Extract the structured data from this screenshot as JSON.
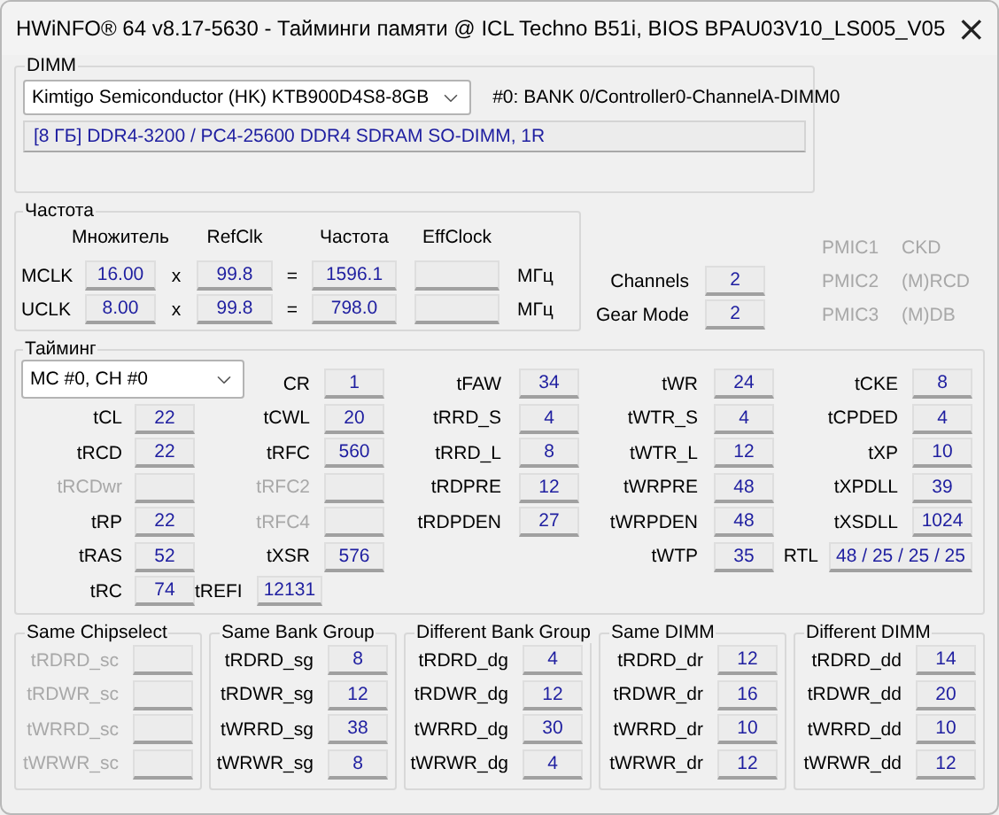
{
  "window": {
    "title": "HWiNFO® 64 v8.17-5630 - Тайминги памяти @ ICL Techno B51i, BIOS BPAU03V10_LS005_V05",
    "close": "×"
  },
  "dimm": {
    "title": "DIMM",
    "module": "Kimtigo Semiconductor (HK) KTB900D4S8-8GB",
    "slot": "#0: BANK 0/Controller0-ChannelA-DIMM0",
    "info": "[8 ГБ] DDR4-3200 / PC4-25600 DDR4 SDRAM SO-DIMM, 1R"
  },
  "frequency": {
    "title": "Частота",
    "columns": [
      "Множитель",
      "RefClk",
      "Частота",
      "EffClock"
    ],
    "rows": [
      {
        "label": "MCLK",
        "multiplier": "16.00",
        "times": "x",
        "refclk": "99.8",
        "equals": "=",
        "frequency": "1596.1",
        "unit": "МГц"
      },
      {
        "label": "UCLK",
        "multiplier": "8.00",
        "times": "x",
        "refclk": "99.8",
        "equals": "=",
        "frequency": "798.0",
        "unit": "МГц"
      }
    ]
  },
  "channels": [
    {
      "label": "Channels",
      "value": "2"
    },
    {
      "label": "Gear Mode",
      "value": "2"
    }
  ],
  "pmic": [
    {
      "label": "PMIC1",
      "value": "CKD",
      "disabled": true
    },
    {
      "label": "PMIC2",
      "value": "(M)RCD",
      "disabled": true
    },
    {
      "label": "PMIC3",
      "value": "(M)DB",
      "disabled": true
    }
  ],
  "timing": {
    "title": "Тайминг",
    "controller": "MC #0, CH #0",
    "columns": [
      [
        {
          "label": "tCL",
          "value": "22",
          "disabled": false
        },
        {
          "label": "tRCD",
          "value": "22",
          "disabled": false
        },
        {
          "label": "tRCDwr",
          "disabled": true
        },
        {
          "label": "tRP",
          "value": "22",
          "disabled": false
        },
        {
          "label": "tRAS",
          "value": "52",
          "disabled": false
        },
        {
          "label": "tRC",
          "value": "74",
          "disabled": false
        }
      ],
      [
        {
          "label": "CR",
          "value": "1",
          "disabled": false
        },
        {
          "label": "tCWL",
          "value": "20",
          "disabled": false
        },
        {
          "label": "tRFC",
          "value": "560",
          "disabled": false
        },
        {
          "label": "tRFC2",
          "disabled": true
        },
        {
          "label": "tRFC4",
          "disabled": true
        },
        {
          "label": "tXSR",
          "value": "576",
          "disabled": false
        },
        {
          "label": "tREFI",
          "value": "12131",
          "disabled": false
        }
      ],
      [
        {
          "label": "tFAW",
          "value": "34",
          "disabled": false
        },
        {
          "label": "tRRD_S",
          "value": "4",
          "disabled": false
        },
        {
          "label": "tRRD_L",
          "value": "8",
          "disabled": false
        },
        {
          "label": "tRDPRE",
          "value": "12",
          "disabled": false
        },
        {
          "label": "tRDPDEN",
          "value": "27",
          "disabled": false
        }
      ],
      [
        {
          "label": "tWR",
          "value": "24",
          "disabled": false
        },
        {
          "label": "tWTR_S",
          "value": "4",
          "disabled": false
        },
        {
          "label": "tWTR_L",
          "value": "12",
          "disabled": false
        },
        {
          "label": "tWRPRE",
          "value": "48",
          "disabled": false
        },
        {
          "label": "tWRPDEN",
          "value": "48",
          "disabled": false
        },
        {
          "label": "tWTP",
          "value": "35",
          "disabled": false
        }
      ],
      [
        {
          "label": "tCKE",
          "value": "8",
          "disabled": false
        },
        {
          "label": "tCPDED",
          "value": "4",
          "disabled": false
        },
        {
          "label": "tXP",
          "value": "10",
          "disabled": false
        },
        {
          "label": "tXPDLL",
          "value": "39",
          "disabled": false
        },
        {
          "label": "tXSDLL",
          "value": "1024",
          "disabled": false
        },
        {
          "label": "RTL",
          "value": "48 / 25 / 25 / 25",
          "disabled": false,
          "kind": "wide"
        }
      ]
    ]
  },
  "groups": [
    {
      "title": "Same Chipselect",
      "items": [
        {
          "label": "tRDRD_sc",
          "disabled": true
        },
        {
          "label": "tRDWR_sc",
          "disabled": true
        },
        {
          "label": "tWRRD_sc",
          "disabled": true
        },
        {
          "label": "tWRWR_sc",
          "disabled": true
        }
      ]
    },
    {
      "title": "Same Bank Group",
      "items": [
        {
          "label": "tRDRD_sg",
          "value": "8",
          "disabled": false
        },
        {
          "label": "tRDWR_sg",
          "value": "12",
          "disabled": false
        },
        {
          "label": "tWRRD_sg",
          "value": "38",
          "disabled": false
        },
        {
          "label": "tWRWR_sg",
          "value": "8",
          "disabled": false
        }
      ]
    },
    {
      "title": "Different Bank Group",
      "items": [
        {
          "label": "tRDRD_dg",
          "value": "4",
          "disabled": false
        },
        {
          "label": "tRDWR_dg",
          "value": "12",
          "disabled": false
        },
        {
          "label": "tWRRD_dg",
          "value": "30",
          "disabled": false
        },
        {
          "label": "tWRWR_dg",
          "value": "4",
          "disabled": false
        }
      ]
    },
    {
      "title": "Same DIMM",
      "items": [
        {
          "label": "tRDRD_dr",
          "value": "12",
          "disabled": false
        },
        {
          "label": "tRDWR_dr",
          "value": "16",
          "disabled": false
        },
        {
          "label": "tWRRD_dr",
          "value": "10",
          "disabled": false
        },
        {
          "label": "tWRWR_dr",
          "value": "12",
          "disabled": false
        }
      ]
    },
    {
      "title": "Different DIMM",
      "items": [
        {
          "label": "tRDRD_dd",
          "value": "14",
          "disabled": false
        },
        {
          "label": "tRDWR_dd",
          "value": "20",
          "disabled": false
        },
        {
          "label": "tWRRD_dd",
          "value": "10",
          "disabled": false
        },
        {
          "label": "tWRWR_dd",
          "value": "12",
          "disabled": false
        }
      ]
    }
  ]
}
